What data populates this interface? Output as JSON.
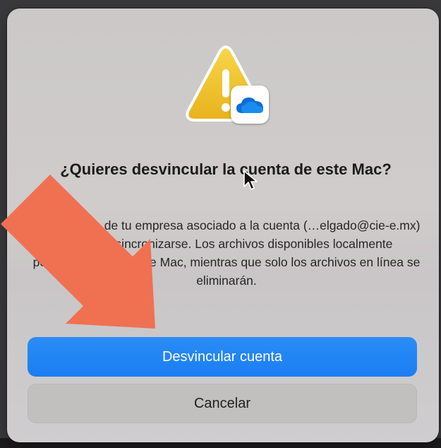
{
  "dialog": {
    "title": "¿Quieres desvincular la cuenta de este Mac?",
    "message": "El contenido de tu empresa asociado a la cuenta (…elgado@cie-e.mx) dejará de sincronizarse. Los archivos disponibles localmente permanecerán en este Mac, mientras que solo los archivos en línea se eliminarán.",
    "primary_button": "Desvincular cuenta",
    "secondary_button": "Cancelar",
    "icons": {
      "app_icon": "warning-triangle-icon",
      "badge": "onedrive-cloud-icon"
    }
  },
  "annotation": {
    "arrow_color": "#f07052",
    "icon": "pointing-arrow-icon"
  },
  "colors": {
    "primary_button": "#1a7ef3",
    "warning_yellow": "#f2c62c",
    "onedrive_blue": "#0f6cd6"
  }
}
